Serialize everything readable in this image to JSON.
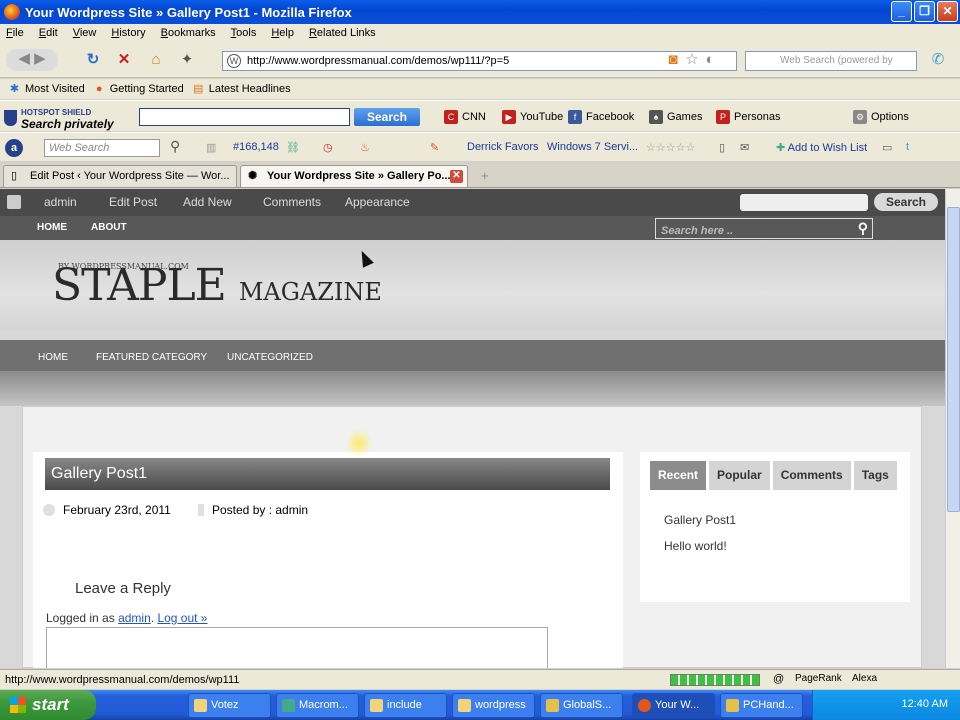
{
  "window": {
    "title": "Your Wordpress Site » Gallery Post1 - Mozilla Firefox"
  },
  "menu": [
    "File",
    "Edit",
    "View",
    "History",
    "Bookmarks",
    "Tools",
    "Help",
    "Related Links"
  ],
  "nav": {
    "url": "http://www.wordpressmanual.com/demos/wp111/?p=5",
    "search_placeholder": "Web Search (powered by"
  },
  "bookmarks": [
    "Most Visited",
    "Getting Started",
    "Latest Headlines"
  ],
  "hotspot": {
    "brand": "HOTSPOT SHIELD",
    "tagline": "Search privately",
    "search_btn": "Search",
    "links": [
      "CNN",
      "YouTube",
      "Facebook",
      "Games",
      "Personas"
    ],
    "options": "Options"
  },
  "alexa_bar": {
    "search_placeholder": "Web Search",
    "count": "#168,148",
    "favs": "Derrick Favors",
    "win7": "Windows 7 Servi...",
    "wish": "Add to Wish List"
  },
  "tabs": [
    {
      "label": "Edit Post ‹ Your Wordpress Site — Wor..."
    },
    {
      "label": "Your Wordpress Site » Gallery Po..."
    }
  ],
  "admin_bar": {
    "items": [
      "admin",
      "Edit Post",
      "Add New",
      "Comments",
      "Appearance"
    ],
    "search_btn": "Search"
  },
  "site_nav": {
    "items": [
      "HOME",
      "ABOUT"
    ],
    "search_placeholder": "Search here .."
  },
  "logo": {
    "small": "BY WORDPRESSMANUAL.COM",
    "main": "STAPLE",
    "sub": "MAGAZINE"
  },
  "categories": [
    "HOME",
    "FEATURED CATEGORY",
    "UNCATEGORIZED"
  ],
  "post": {
    "title": "Gallery Post1",
    "date": "February 23rd, 2011",
    "author": "Posted by : admin",
    "reply_heading": "Leave a Reply",
    "logged_in_prefix": "Logged in as",
    "user": "admin",
    "logout": "Log out »"
  },
  "sidebar": {
    "tabs": [
      "Recent",
      "Popular",
      "Comments",
      "Tags"
    ],
    "items": [
      "Gallery Post1",
      "Hello world!"
    ]
  },
  "status": {
    "url": "http://www.wordpressmanual.com/demos/wp111",
    "pagerank": "PageRank",
    "alexa": "Alexa"
  },
  "taskbar": {
    "start": "start",
    "tasks": [
      "Votez",
      "Macrom...",
      "include",
      "wordpress",
      "GlobalS...",
      "Your W...",
      "PCHand..."
    ],
    "clock": "12:40 AM"
  }
}
